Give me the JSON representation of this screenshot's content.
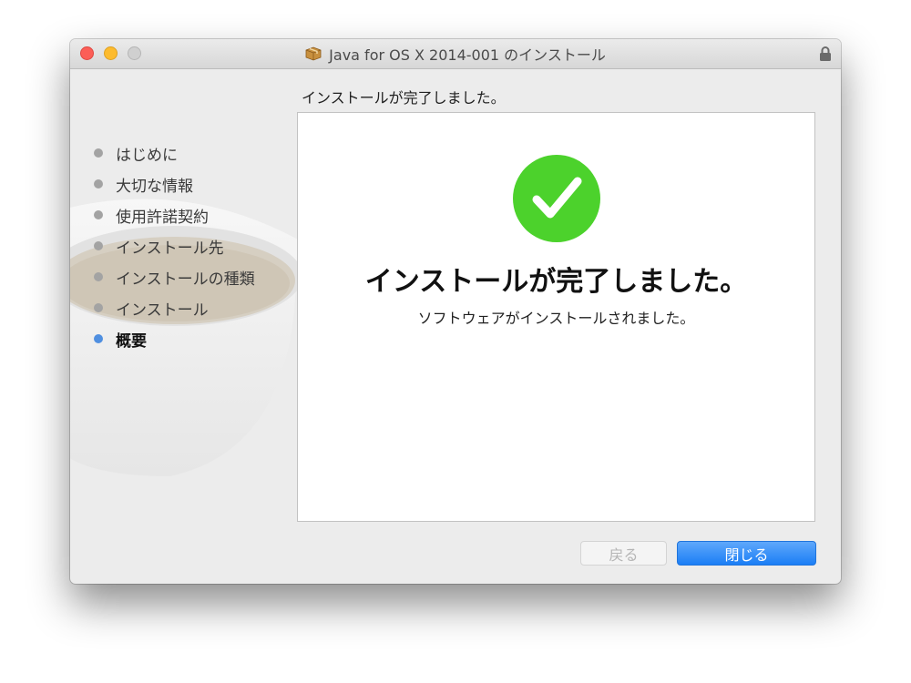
{
  "window": {
    "title": "Java for OS X 2014-001 のインストール",
    "icons": {
      "package": "package-icon",
      "lock": "lock-icon"
    }
  },
  "sidebar": {
    "steps": [
      {
        "label": "はじめに",
        "active": false
      },
      {
        "label": "大切な情報",
        "active": false
      },
      {
        "label": "使用許諾契約",
        "active": false
      },
      {
        "label": "インストール先",
        "active": false
      },
      {
        "label": "インストールの種類",
        "active": false
      },
      {
        "label": "インストール",
        "active": false
      },
      {
        "label": "概要",
        "active": true
      }
    ]
  },
  "main": {
    "heading": "インストールが完了しました。",
    "success_title": "インストールが完了しました。",
    "success_subtitle": "ソフトウェアがインストールされました。",
    "success_icon": "checkmark-circle-icon"
  },
  "buttons": {
    "back_label": "戻る",
    "close_label": "閉じる"
  },
  "colors": {
    "accent": "#1b7ef5",
    "success_green": "#4cd22c",
    "active_bullet": "#4f8fe0"
  }
}
